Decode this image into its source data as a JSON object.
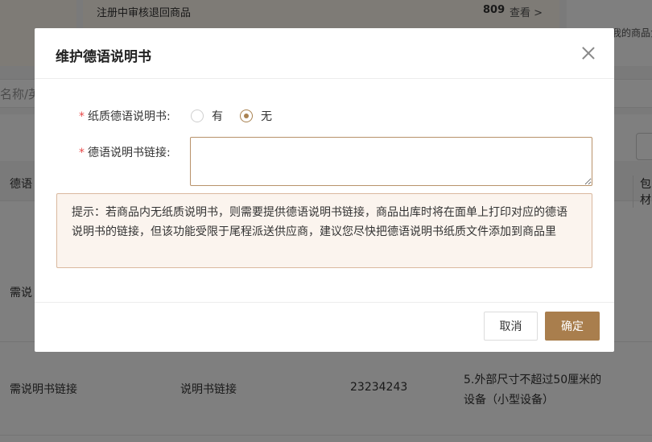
{
  "background": {
    "summary_row_label": "注册中审核退回商品",
    "summary_row_count": "809",
    "summary_row_link": "查看 >",
    "right_card_text": "我的商品负责",
    "search_placeholder": "名称/英",
    "table_header_col1": "德语",
    "table_header_col_last": "包材",
    "row1_col1": "需说",
    "row2": {
      "col1": "需说明书链接",
      "col2": "说明书链接",
      "col3": "23234243",
      "col4_line1": "5.外部尺寸不超过50厘米的",
      "col4_line2": "设备（小型设备）"
    }
  },
  "dialog": {
    "title": "维护德语说明书",
    "paper_manual": {
      "required_mark": "*",
      "label": "纸质德语说明书:",
      "options": [
        "有",
        "无"
      ],
      "selected": "无"
    },
    "manual_link": {
      "required_mark": "*",
      "label": "德语说明书链接:",
      "value": "",
      "placeholder": ""
    },
    "notice": "提示：若商品内无纸质说明书，则需要提供德语说明书链接，商品出库时将在面单上打印对应的德语说明书的链接，但该功能受限于尾程派送供应商，建议您尽快把德语说明书纸质文件添加到商品里",
    "buttons": {
      "cancel": "取消",
      "confirm": "确定"
    }
  },
  "colors": {
    "accent": "#a97e4d",
    "required": "#e84a4a",
    "notice_bg": "#fbf4ee",
    "notice_border": "#dab89e",
    "overlay": "rgba(0,0,0,0.5)"
  },
  "icons": {
    "close": "close-icon"
  }
}
